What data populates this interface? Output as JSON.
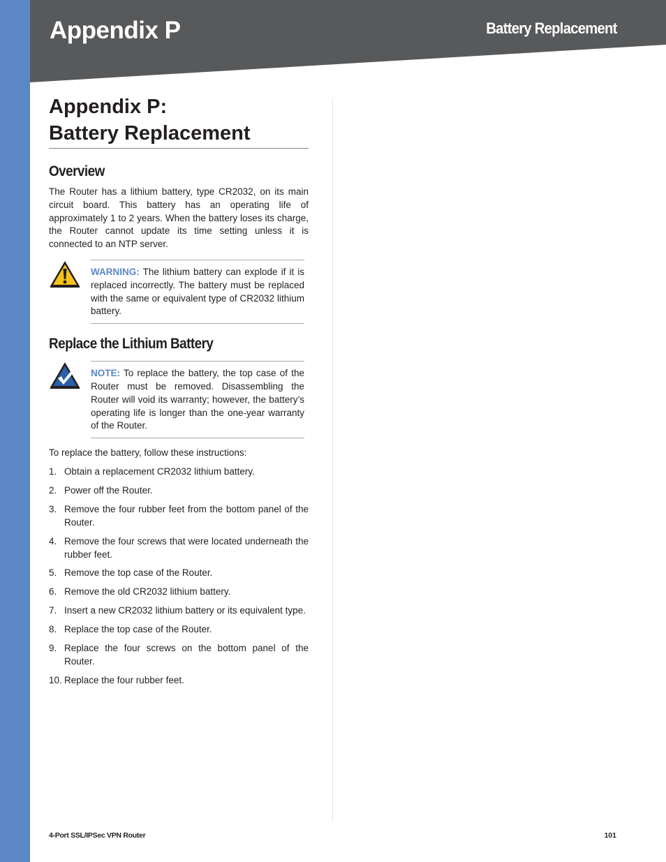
{
  "header": {
    "chapter_title": "Appendix P",
    "section_title": "Battery Replacement"
  },
  "colors": {
    "accent_blue": "#5b87c7",
    "header_gray": "#58595b",
    "warning_yellow": "#f5c21b",
    "note_blue": "#2a5ea8"
  },
  "main": {
    "page_title_line1": "Appendix P:",
    "page_title_line2": "Battery Replacement",
    "overview": {
      "heading": "Overview",
      "body": "The Router has a lithium battery, type CR2032, on its main circuit board. This battery has an operating life of approximately 1 to 2 years. When the battery loses its charge, the Router cannot update its time setting unless it is connected to an NTP server."
    },
    "warning": {
      "icon": "warning-triangle-icon",
      "label": "WARNING:",
      "text": " The lithium battery can explode if it is replaced incorrectly. The battery must be replaced with the same or equivalent type of CR2032 lithium battery."
    },
    "replace": {
      "heading": "Replace the Lithium Battery",
      "note": {
        "icon": "checkmark-triangle-icon",
        "label": "NOTE:",
        "text": " To replace the battery, the top case of the Router must be removed. Disassembling the Router will void its warranty; however, the battery’s operating life is longer than the one-year warranty of the Router."
      },
      "intro": "To replace the battery, follow these instructions:",
      "steps": [
        {
          "num": "1.",
          "text": "Obtain a replacement CR2032 lithium battery."
        },
        {
          "num": "2.",
          "text": "Power off the Router."
        },
        {
          "num": "3.",
          "text": "Remove the four rubber feet from the bottom panel of the Router."
        },
        {
          "num": "4.",
          "text": "Remove the four screws that were located underneath the rubber feet."
        },
        {
          "num": "5.",
          "text": "Remove the top case of the Router."
        },
        {
          "num": "6.",
          "text": "Remove the old CR2032 lithium battery."
        },
        {
          "num": "7.",
          "text": "Insert a new CR2032 lithium battery or its equivalent type."
        },
        {
          "num": "8.",
          "text": "Replace the top case of the Router."
        },
        {
          "num": "9.",
          "text": "Replace the four screws on the bottom panel of the Router."
        },
        {
          "num": "10.",
          "text": "Replace the four rubber feet."
        }
      ]
    }
  },
  "footer": {
    "product_name": "4-Port SSL/IPSec VPN Router",
    "page_number": "101"
  }
}
